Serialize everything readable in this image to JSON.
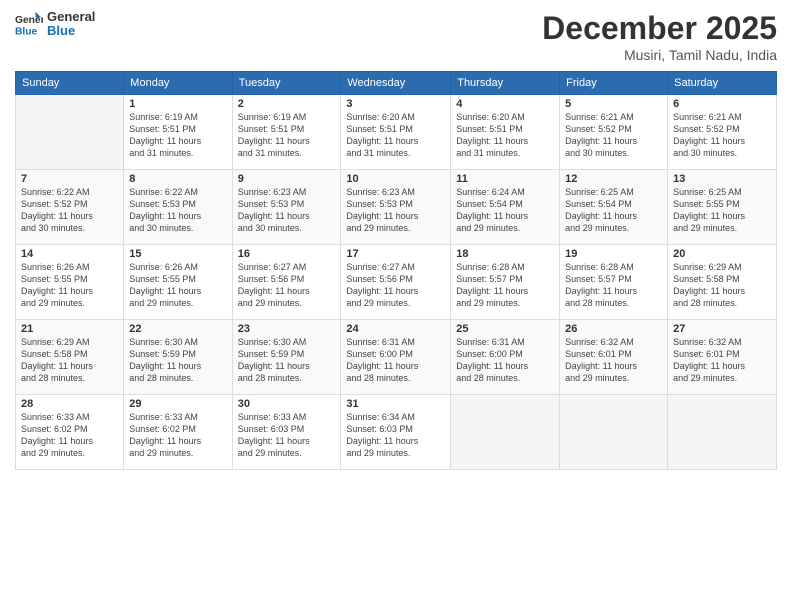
{
  "logo": {
    "line1": "General",
    "line2": "Blue"
  },
  "title": "December 2025",
  "location": "Musiri, Tamil Nadu, India",
  "days_of_week": [
    "Sunday",
    "Monday",
    "Tuesday",
    "Wednesday",
    "Thursday",
    "Friday",
    "Saturday"
  ],
  "weeks": [
    [
      {
        "day": "",
        "info": ""
      },
      {
        "day": "1",
        "info": "Sunrise: 6:19 AM\nSunset: 5:51 PM\nDaylight: 11 hours\nand 31 minutes."
      },
      {
        "day": "2",
        "info": "Sunrise: 6:19 AM\nSunset: 5:51 PM\nDaylight: 11 hours\nand 31 minutes."
      },
      {
        "day": "3",
        "info": "Sunrise: 6:20 AM\nSunset: 5:51 PM\nDaylight: 11 hours\nand 31 minutes."
      },
      {
        "day": "4",
        "info": "Sunrise: 6:20 AM\nSunset: 5:51 PM\nDaylight: 11 hours\nand 31 minutes."
      },
      {
        "day": "5",
        "info": "Sunrise: 6:21 AM\nSunset: 5:52 PM\nDaylight: 11 hours\nand 30 minutes."
      },
      {
        "day": "6",
        "info": "Sunrise: 6:21 AM\nSunset: 5:52 PM\nDaylight: 11 hours\nand 30 minutes."
      }
    ],
    [
      {
        "day": "7",
        "info": "Sunrise: 6:22 AM\nSunset: 5:52 PM\nDaylight: 11 hours\nand 30 minutes."
      },
      {
        "day": "8",
        "info": "Sunrise: 6:22 AM\nSunset: 5:53 PM\nDaylight: 11 hours\nand 30 minutes."
      },
      {
        "day": "9",
        "info": "Sunrise: 6:23 AM\nSunset: 5:53 PM\nDaylight: 11 hours\nand 30 minutes."
      },
      {
        "day": "10",
        "info": "Sunrise: 6:23 AM\nSunset: 5:53 PM\nDaylight: 11 hours\nand 29 minutes."
      },
      {
        "day": "11",
        "info": "Sunrise: 6:24 AM\nSunset: 5:54 PM\nDaylight: 11 hours\nand 29 minutes."
      },
      {
        "day": "12",
        "info": "Sunrise: 6:25 AM\nSunset: 5:54 PM\nDaylight: 11 hours\nand 29 minutes."
      },
      {
        "day": "13",
        "info": "Sunrise: 6:25 AM\nSunset: 5:55 PM\nDaylight: 11 hours\nand 29 minutes."
      }
    ],
    [
      {
        "day": "14",
        "info": "Sunrise: 6:26 AM\nSunset: 5:55 PM\nDaylight: 11 hours\nand 29 minutes."
      },
      {
        "day": "15",
        "info": "Sunrise: 6:26 AM\nSunset: 5:55 PM\nDaylight: 11 hours\nand 29 minutes."
      },
      {
        "day": "16",
        "info": "Sunrise: 6:27 AM\nSunset: 5:56 PM\nDaylight: 11 hours\nand 29 minutes."
      },
      {
        "day": "17",
        "info": "Sunrise: 6:27 AM\nSunset: 5:56 PM\nDaylight: 11 hours\nand 29 minutes."
      },
      {
        "day": "18",
        "info": "Sunrise: 6:28 AM\nSunset: 5:57 PM\nDaylight: 11 hours\nand 29 minutes."
      },
      {
        "day": "19",
        "info": "Sunrise: 6:28 AM\nSunset: 5:57 PM\nDaylight: 11 hours\nand 28 minutes."
      },
      {
        "day": "20",
        "info": "Sunrise: 6:29 AM\nSunset: 5:58 PM\nDaylight: 11 hours\nand 28 minutes."
      }
    ],
    [
      {
        "day": "21",
        "info": "Sunrise: 6:29 AM\nSunset: 5:58 PM\nDaylight: 11 hours\nand 28 minutes."
      },
      {
        "day": "22",
        "info": "Sunrise: 6:30 AM\nSunset: 5:59 PM\nDaylight: 11 hours\nand 28 minutes."
      },
      {
        "day": "23",
        "info": "Sunrise: 6:30 AM\nSunset: 5:59 PM\nDaylight: 11 hours\nand 28 minutes."
      },
      {
        "day": "24",
        "info": "Sunrise: 6:31 AM\nSunset: 6:00 PM\nDaylight: 11 hours\nand 28 minutes."
      },
      {
        "day": "25",
        "info": "Sunrise: 6:31 AM\nSunset: 6:00 PM\nDaylight: 11 hours\nand 28 minutes."
      },
      {
        "day": "26",
        "info": "Sunrise: 6:32 AM\nSunset: 6:01 PM\nDaylight: 11 hours\nand 29 minutes."
      },
      {
        "day": "27",
        "info": "Sunrise: 6:32 AM\nSunset: 6:01 PM\nDaylight: 11 hours\nand 29 minutes."
      }
    ],
    [
      {
        "day": "28",
        "info": "Sunrise: 6:33 AM\nSunset: 6:02 PM\nDaylight: 11 hours\nand 29 minutes."
      },
      {
        "day": "29",
        "info": "Sunrise: 6:33 AM\nSunset: 6:02 PM\nDaylight: 11 hours\nand 29 minutes."
      },
      {
        "day": "30",
        "info": "Sunrise: 6:33 AM\nSunset: 6:03 PM\nDaylight: 11 hours\nand 29 minutes."
      },
      {
        "day": "31",
        "info": "Sunrise: 6:34 AM\nSunset: 6:03 PM\nDaylight: 11 hours\nand 29 minutes."
      },
      {
        "day": "",
        "info": ""
      },
      {
        "day": "",
        "info": ""
      },
      {
        "day": "",
        "info": ""
      }
    ]
  ]
}
